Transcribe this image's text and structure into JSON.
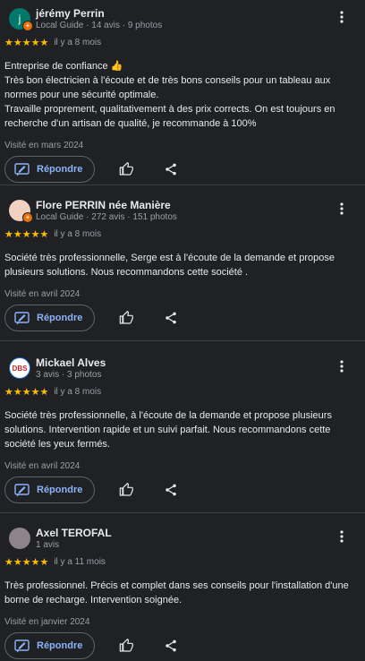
{
  "accent": "#8ab4f8",
  "star_color": "#fbbc04",
  "reviews": [
    {
      "name": "jérémy Perrin",
      "meta": "Local Guide · 14 avis · 9 photos",
      "avatar_letter": "j",
      "avatar_color": "#00796b",
      "local_guide": true,
      "rating": 5,
      "stars": "★★★★★",
      "time": "il y a 8 mois",
      "text": "Entreprise de confiance 👍\nTrès bon électricien à l'écoute et de très bons conseils pour un tableau aux normes pour une sécurité optimale.\nTravaille proprement, qualitativement à des prix corrects. On est toujours en recherche d'un artisan de qualité, je recommande à 100%",
      "visit": "Visité en mars 2024",
      "reply_label": "Répondre"
    },
    {
      "name": "Flore PERRIN née Manière",
      "meta": "Local Guide · 272 avis · 151 photos",
      "avatar_letter": "",
      "avatar_color": "#f1d2c2",
      "local_guide": true,
      "rating": 5,
      "stars": "★★★★★",
      "time": "il y a 8 mois",
      "text": "Société très professionnelle, Serge est à l'écoute de la demande et propose plusieurs solutions. Nous recommandons cette société .",
      "visit": "Visité en avril 2024",
      "reply_label": "Répondre"
    },
    {
      "name": "Mickael Alves",
      "meta": "3 avis · 3 photos",
      "avatar_letter": "DBS",
      "avatar_color": "#ffffff",
      "local_guide": false,
      "rating": 5,
      "stars": "★★★★★",
      "time": "il y a 8 mois",
      "text": "Société très professionnelle, à l'écoute de la demande et propose plusieurs solutions. Intervention rapide et un suivi parfait. Nous recommandons cette société les yeux fermés.",
      "visit": "Visité en avril 2024",
      "reply_label": "Répondre"
    },
    {
      "name": "Axel TEROFAL",
      "meta": "1 avis",
      "avatar_letter": "",
      "avatar_color": "#8d8389",
      "local_guide": false,
      "rating": 5,
      "stars": "★★★★★",
      "time": "il y a 11 mois",
      "text": "Très professionnel. Précis et complet dans ses conseils pour l'installation d'une borne de recharge. Intervention soignée.",
      "visit": "Visité en janvier 2024",
      "reply_label": "Répondre"
    }
  ]
}
